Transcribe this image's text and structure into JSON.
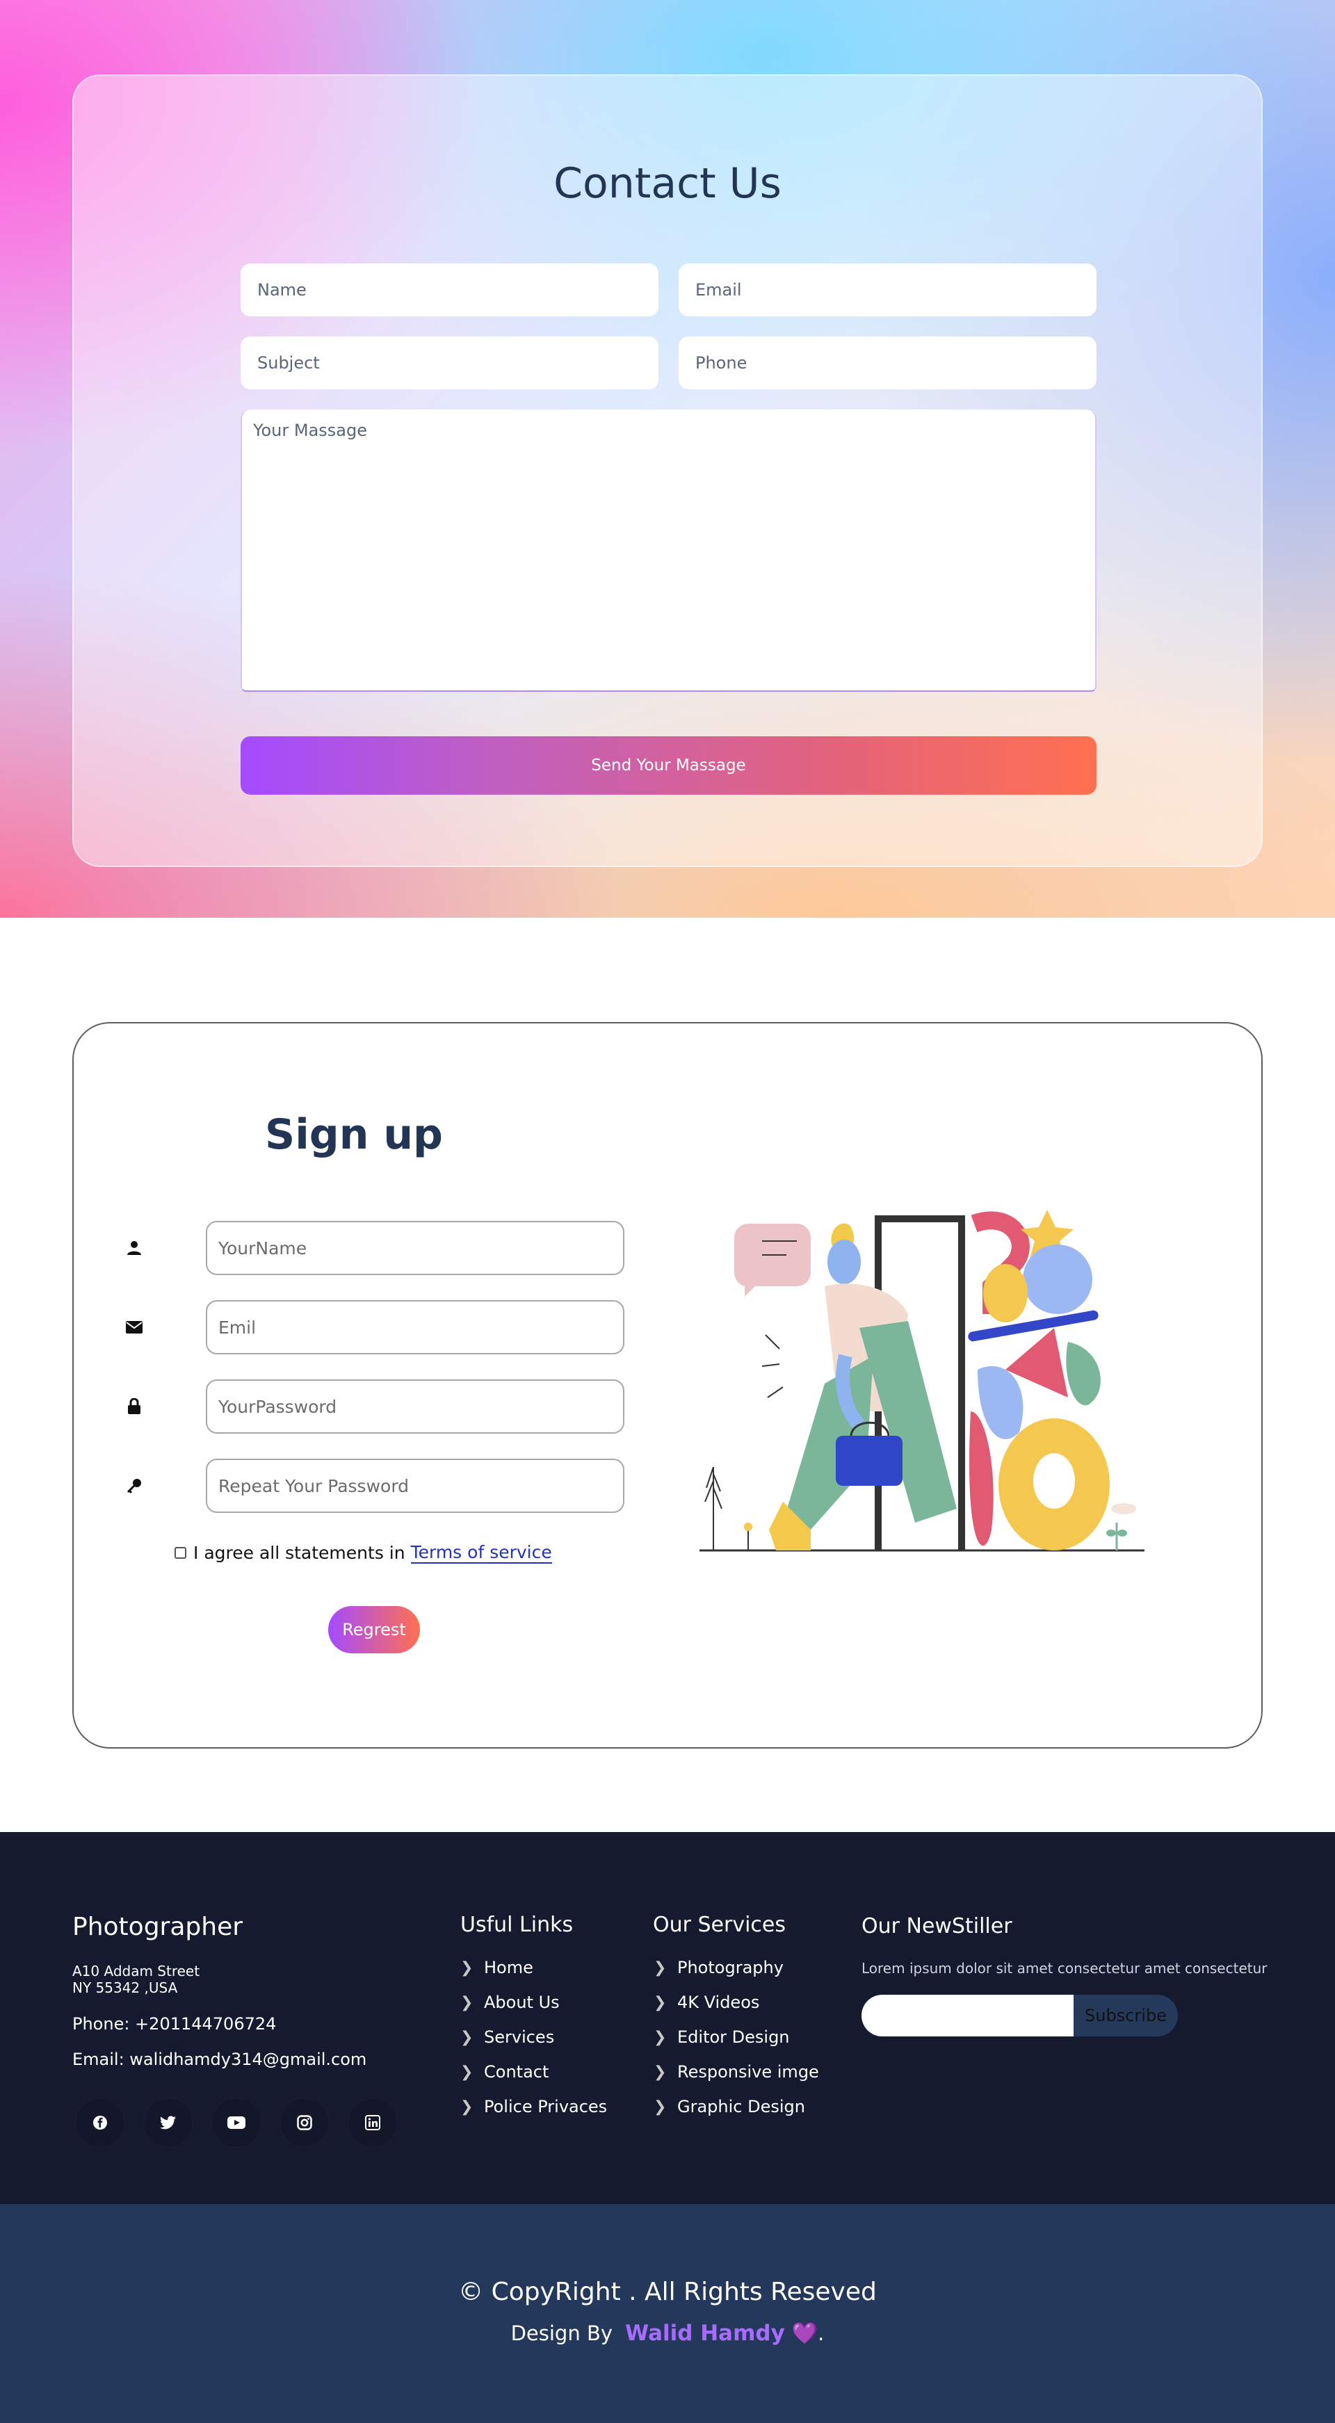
{
  "contact": {
    "title": "Contact Us",
    "fields": {
      "name_placeholder": "Name",
      "email_placeholder": "Email",
      "subject_placeholder": "Subject",
      "phone_placeholder": "Phone",
      "message_placeholder": "Your Massage"
    },
    "send_label": "Send Your Massage"
  },
  "signup": {
    "title": "Sign up",
    "fields": {
      "name_placeholder": "YourName",
      "email_placeholder": "Emil",
      "password_placeholder": "YourPassword",
      "repeat_placeholder": "Repeat Your Password"
    },
    "agree_text": "I agree all statements in",
    "terms_label": "Terms of service",
    "register_label": "Regrest",
    "icons": [
      "user-icon",
      "envelope-icon",
      "lock-icon",
      "key-icon"
    ]
  },
  "footer": {
    "brand": "Photographer",
    "address_line1": "A10 Addam Street",
    "address_line2": "NY 55342 ,USA",
    "phone": "Phone: +201144706724",
    "email": "Email: walidhamdy314@gmail.com",
    "socials": [
      "facebook-icon",
      "twitter-icon",
      "youtube-icon",
      "instagram-icon",
      "linkedin-icon"
    ],
    "links_title": "Usful Links",
    "links": [
      "Home",
      "About Us",
      "Services",
      "Contact",
      "Police Privaces"
    ],
    "services_title": "Our Services",
    "services": [
      "Photography",
      "4K Videos",
      "Editor Design",
      "Responsive imge",
      "Graphic Design"
    ],
    "newsletter_title": "Our NewStiller",
    "newsletter_text": "Lorem ipsum dolor sit amet consectetur amet consectetur",
    "subscribe_label": "Subscribe"
  },
  "bottom": {
    "copyright": "© CopyRight . All Rights Reseved",
    "design_by": "Design By",
    "author": "Walid Hamdy",
    "heart": "💜",
    "period": "."
  },
  "colors": {
    "accent_start": "#a44bff",
    "accent_end": "#ff7050",
    "footer_bg": "#161a2e",
    "copyright_bg": "#23385a",
    "title_color": "#233554"
  }
}
